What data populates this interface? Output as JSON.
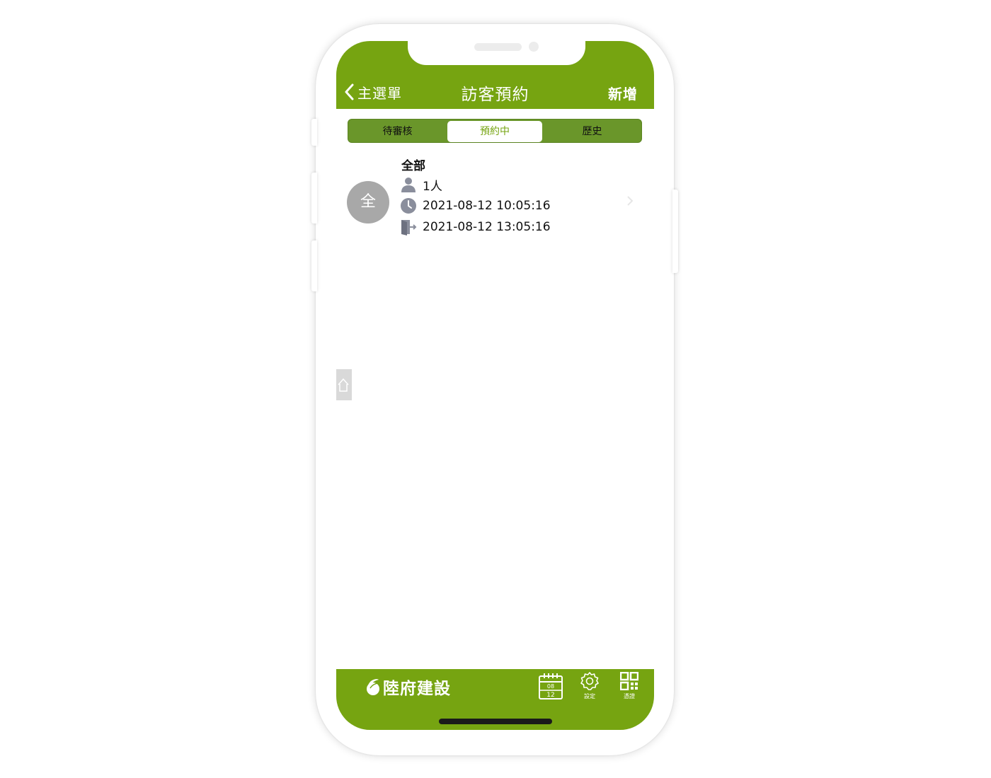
{
  "header": {
    "back_label": "主選單",
    "title": "訪客預約",
    "add_label": "新增"
  },
  "tabs": [
    {
      "label": "待審核",
      "active": false
    },
    {
      "label": "預約中",
      "active": true
    },
    {
      "label": "歷史",
      "active": false
    }
  ],
  "reservation": {
    "avatar_text": "全",
    "name": "全部",
    "count": "1人",
    "start_time": "2021-08-12 10:05:16",
    "end_time": "2021-08-12 13:05:16"
  },
  "footer": {
    "brand": "陸府建設",
    "calendar_month": "08",
    "calendar_day": "12",
    "settings_label": "設定",
    "qr_label": "憑證"
  },
  "colors": {
    "accent": "#76a411",
    "segment_bg": "#6a962a",
    "avatar": "#a8a8a8",
    "icon_gray": "#8a8e9c"
  }
}
